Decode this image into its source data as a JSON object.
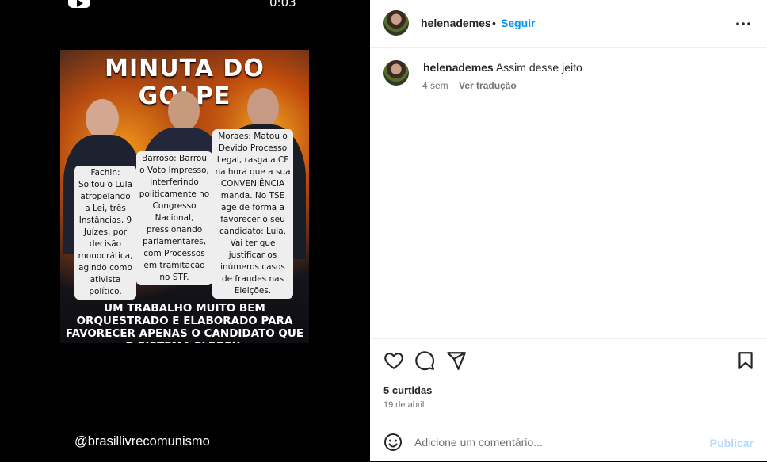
{
  "media": {
    "time": "0:03",
    "poster": {
      "title": "MINUTA DO GOLPE",
      "bubble_fachin": "Fachin: Soltou o Lula atropelando a Lei, três Instâncias, 9 Juízes, por decisão monocrática, agindo como ativista político.",
      "bubble_barroso": "Barroso: Barrou o Voto Impresso, interferindo politicamente no Congresso Nacional, pressionando parlamentares, com Processos em tramitação no STF.",
      "bubble_moraes": "Moraes: Matou o Devido Processo Legal, rasga a CF na hora que a sua CONVENIÊNCIA manda. No TSE age de forma a favorecer o seu candidato: Lula. Vai ter que justificar os inúmeros casos de fraudes nas Eleições.",
      "footer": "UM TRABALHO MUITO BEM ORQUESTRADO E ELABORADO PARA FAVORECER APENAS O CANDIDATO QUE O SISTEMA ELEGEU."
    },
    "watermark": "@brasillivrecomunismo"
  },
  "header": {
    "username": "helenademes",
    "separator": "•",
    "follow_label": "Seguir"
  },
  "caption": {
    "username": "helenademes",
    "text": "Assim desse jeito",
    "age": "4 sem",
    "translate_label": "Ver tradução"
  },
  "engagement": {
    "likes": "5 curtidas",
    "date": "19 de abril"
  },
  "comment": {
    "placeholder": "Adicione um comentário...",
    "publish_label": "Publicar"
  },
  "colors": {
    "accent": "#0095f6",
    "publish_disabled": "#b3dbff"
  }
}
